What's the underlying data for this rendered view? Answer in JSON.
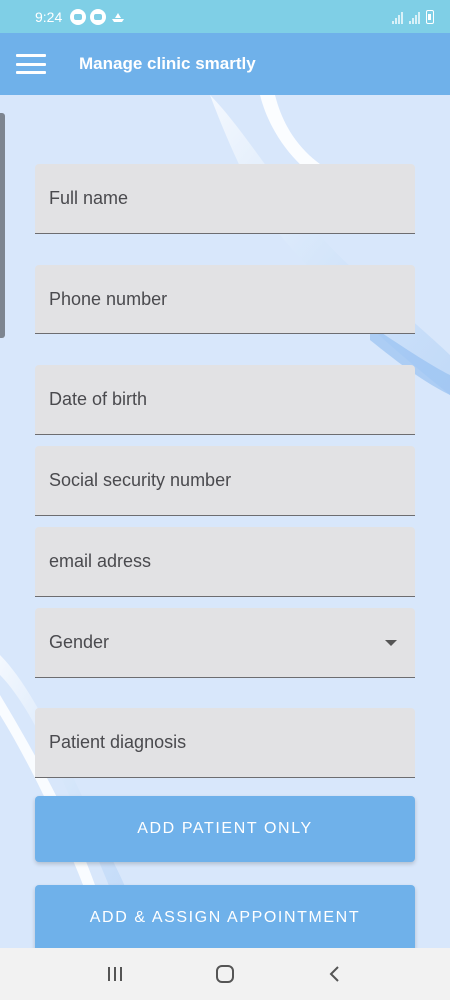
{
  "status_bar": {
    "time": "9:24"
  },
  "app_bar": {
    "title": "Manage clinic smartly",
    "menu_icon": "hamburger-menu-icon"
  },
  "form": {
    "full_name": {
      "placeholder": "Full name"
    },
    "phone_number": {
      "placeholder": "Phone number"
    },
    "date_of_birth": {
      "placeholder": "Date of birth"
    },
    "ssn": {
      "placeholder": "Social security number"
    },
    "email": {
      "placeholder": "email adress"
    },
    "gender": {
      "selected": "Gender"
    },
    "diagnosis": {
      "placeholder": "Patient diagnosis"
    }
  },
  "buttons": {
    "add_patient_only": "ADD PATIENT ONLY",
    "add_assign_appointment": "ADD & ASSIGN APPOINTMENT"
  },
  "nav": {
    "recents_icon": "recents-icon",
    "home_icon": "home-icon",
    "back_icon": "back-icon"
  },
  "colors": {
    "status_bar": "#7fcfe6",
    "app_bar": "#6fb1ea",
    "background": "#d8e7fb",
    "field": "#e2e2e4",
    "button": "#6fb1ea"
  }
}
